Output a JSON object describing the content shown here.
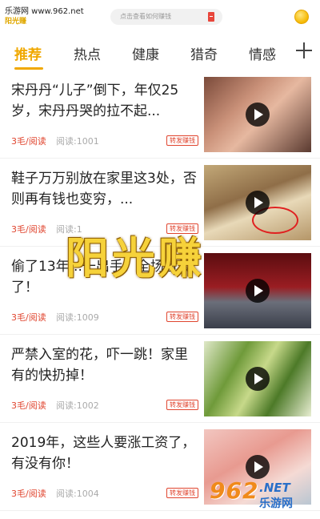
{
  "top": {
    "watermark": "乐游网 www.962.net",
    "app_logo": "阳光赚",
    "search_placeholder": "点击查看如何赚钱"
  },
  "tabs": [
    {
      "label": "推荐",
      "active": true
    },
    {
      "label": "热点",
      "active": false
    },
    {
      "label": "健康",
      "active": false
    },
    {
      "label": "猎奇",
      "active": false
    },
    {
      "label": "情感",
      "active": false
    }
  ],
  "add_tab_icon": "plus-icon",
  "feed": [
    {
      "title": "宋丹丹“儿子”倒下，年仅25岁，宋丹丹哭的拉不起...",
      "reward": "3毛/阅读",
      "reads": "阅读:1001",
      "badge": "转发赚钱"
    },
    {
      "title": "鞋子万万别放在家里这3处，否则再有钱也变穷，...",
      "reward": "3毛/阅读",
      "reads": "阅读:1",
      "badge": "转发赚钱"
    },
    {
      "title": "偷了13年...一出手，全场看傻了！",
      "reward": "3毛/阅读",
      "reads": "阅读:1009",
      "badge": "转发赚钱"
    },
    {
      "title": "严禁入室的花，吓一跳！家里有的快扔掉！",
      "reward": "3毛/阅读",
      "reads": "阅读:1002",
      "badge": "转发赚钱"
    },
    {
      "title": "2019年，这些人要涨工资了，有没有你！",
      "reward": "3毛/阅读",
      "reads": "阅读:1004",
      "badge": "转发赚钱"
    }
  ],
  "overlay_brand": "阳光赚",
  "watermark_brand": {
    "number": "962",
    "net": ".NET",
    "site": "乐游网"
  },
  "colors": {
    "accent": "#f0a800",
    "reward": "#e0452f"
  }
}
